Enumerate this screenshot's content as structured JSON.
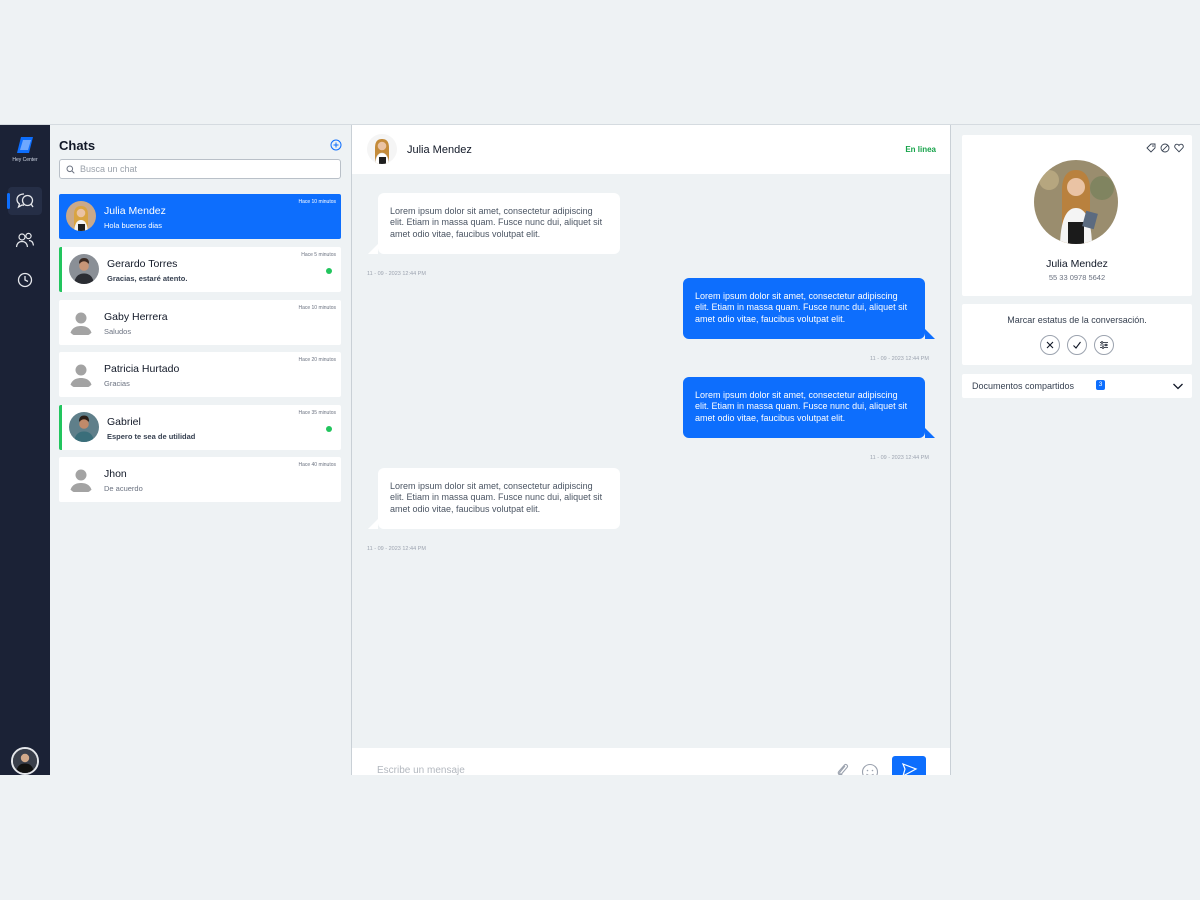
{
  "brand": {
    "name": "Hey Center"
  },
  "rail": {
    "items": [
      "chat-bubbles-icon",
      "users-icon",
      "clock-icon"
    ]
  },
  "chats": {
    "title": "Chats",
    "search_placeholder": "Busca un chat",
    "items": [
      {
        "name": "Julia Mendez",
        "last_message": "Hola buenos dias",
        "time": "Hace 10 minutos",
        "selected": true,
        "unread": false
      },
      {
        "name": "Gerardo Torres",
        "last_message": "Gracias, estaré atento.",
        "time": "Hace 5 minutos",
        "selected": false,
        "unread": true
      },
      {
        "name": "Gaby Herrera",
        "last_message": "Saludos",
        "time": "Hace 10 minutos",
        "selected": false,
        "unread": false
      },
      {
        "name": "Patricia Hurtado",
        "last_message": "Gracias",
        "time": "Hace 20 minutos",
        "selected": false,
        "unread": false
      },
      {
        "name": "Gabriel",
        "last_message": "Espero te sea de utilidad",
        "time": "Hace 35 minutos",
        "selected": false,
        "unread": true
      },
      {
        "name": "Jhon",
        "last_message": "De acuerdo",
        "time": "Hace 40 minutos",
        "selected": false,
        "unread": false
      }
    ]
  },
  "conversation": {
    "contact_name": "Julia Mendez",
    "status": "En linea",
    "messages": [
      {
        "direction": "in",
        "text": "Lorem ipsum dolor sit amet, consectetur adipiscing elit. Etiam in massa quam. Fusce nunc dui, aliquet sit amet odio vitae, faucibus volutpat elit.",
        "timestamp": "11 - 09 - 2023 12:44 PM"
      },
      {
        "direction": "out",
        "text": "Lorem ipsum dolor sit amet, consectetur adipiscing elit. Etiam in massa quam. Fusce nunc dui, aliquet sit amet odio vitae, faucibus volutpat elit.",
        "timestamp": "11 - 09 - 2023 12:44 PM"
      },
      {
        "direction": "out",
        "text": "Lorem ipsum dolor sit amet, consectetur adipiscing elit. Etiam in massa quam. Fusce nunc dui, aliquet sit amet odio vitae, faucibus volutpat elit.",
        "timestamp": "11 - 09 - 2023 12:44 PM"
      },
      {
        "direction": "in",
        "text": "Lorem ipsum dolor sit amet, consectetur adipiscing elit. Etiam in massa quam. Fusce nunc dui, aliquet sit amet odio vitae, faucibus volutpat elit.",
        "timestamp": "11 - 09 - 2023 12:44 PM"
      }
    ],
    "composer_placeholder": "Escribe un mensaje"
  },
  "details": {
    "name": "Julia Mendez",
    "phone": "55 33 0978 5642",
    "status_title": "Marcar estatus de la conversación.",
    "documents_label": "Documentos compartidos",
    "documents_count": "3"
  },
  "colors": {
    "accent": "#0d6efd",
    "rail": "#1b2236",
    "online": "#16a34a",
    "unread": "#22c55e"
  }
}
